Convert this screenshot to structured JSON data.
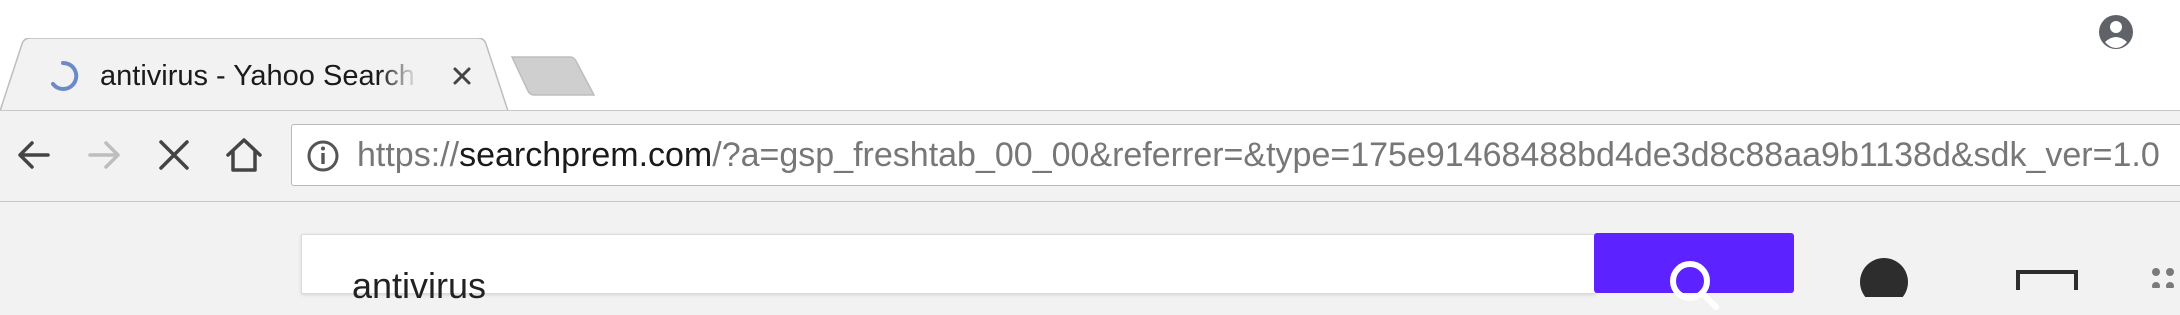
{
  "tab": {
    "title": "antivirus - Yahoo Search Results",
    "loading": true,
    "icons": [
      "loading-spinner-icon",
      "close-icon"
    ]
  },
  "toolbar": {
    "icons": [
      "back-arrow-icon",
      "forward-arrow-icon",
      "stop-icon",
      "home-icon",
      "info-icon"
    ],
    "url": {
      "scheme": "https://",
      "host": "searchprem.com",
      "rest": "/?a=gsp_freshtab_00_00&referrer=&type=175e91468488bd4de3d8c88aa9b1138d&sdk_ver=1.0"
    }
  },
  "page": {
    "search_value": "antivirus",
    "icons": [
      "search-icon",
      "account-icon",
      "mail-icon",
      "apps-grid-icon"
    ]
  },
  "colors": {
    "search_button": "#5c22ff",
    "spinner": "#6a8ac8",
    "forward_disabled": "#bdbdbd"
  }
}
